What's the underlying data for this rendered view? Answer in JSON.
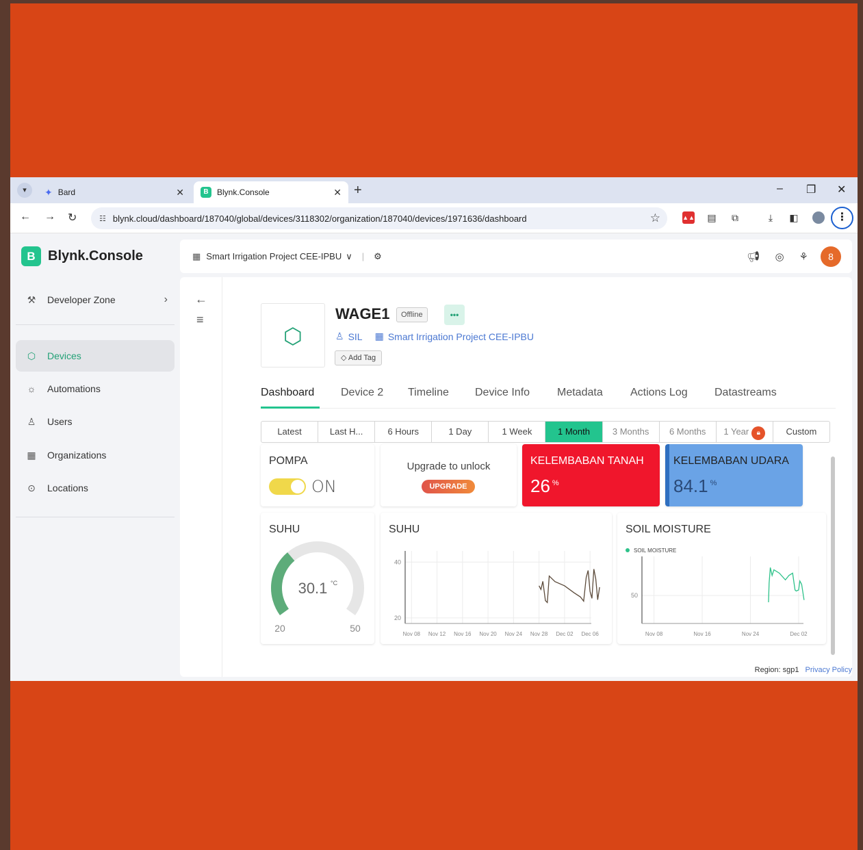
{
  "browser": {
    "tabs": [
      {
        "title": "Bard"
      },
      {
        "title": "Blynk.Console"
      }
    ],
    "url": "blynk.cloud/dashboard/187040/global/devices/3118302/organization/187040/devices/1971636/dashboard",
    "new_tab": "+",
    "win_min": "–",
    "win_max": "❐",
    "win_close": "✕"
  },
  "app": {
    "logo_letter": "B",
    "logo_text": "Blynk.Console",
    "org_name": "Smart Irrigation Project CEE-IPBU",
    "sidebar": [
      {
        "label": "Developer Zone",
        "icon": "tools-icon"
      },
      {
        "label": "Devices",
        "icon": "cube-icon"
      },
      {
        "label": "Automations",
        "icon": "automation-icon"
      },
      {
        "label": "Users",
        "icon": "users-icon"
      },
      {
        "label": "Organizations",
        "icon": "building-icon"
      },
      {
        "label": "Locations",
        "icon": "location-pin-icon"
      }
    ],
    "avatar_letter": "8"
  },
  "device": {
    "name": "WAGE1",
    "status": "Offline",
    "more": "•••",
    "owner": "SIL",
    "organization": "Smart Irrigation Project CEE-IPBU",
    "add_tag": "Add Tag"
  },
  "tabs": [
    "Dashboard",
    "Device 2",
    "Timeline",
    "Device Info",
    "Metadata",
    "Actions Log",
    "Datastreams"
  ],
  "ranges": [
    "Latest",
    "Last H...",
    "6 Hours",
    "1 Day",
    "1 Week",
    "1 Month",
    "3 Months",
    "6 Months",
    "1 Year",
    "Custom"
  ],
  "active_range": "1 Month",
  "widgets": {
    "pompa": {
      "title": "POMPA",
      "state": "ON"
    },
    "upgrade": {
      "text": "Upgrade to unlock",
      "button": "UPGRADE"
    },
    "tanah": {
      "title": "KELEMBABAN TANAH",
      "value": "26",
      "unit": "%",
      "color": "#f0162c"
    },
    "udara": {
      "title": "KELEMBABAN UDARA",
      "value": "84.1",
      "unit": "%",
      "color": "#6aa3e6"
    },
    "gauge": {
      "title": "SUHU",
      "value": "30.1",
      "unit": "°C",
      "min": "20",
      "max": "50",
      "fraction": 0.34,
      "color": "#5dac7a"
    }
  },
  "chart_data": [
    {
      "type": "line",
      "title": "SUHU",
      "ylim": [
        18,
        44
      ],
      "yticks": [
        "40",
        "20"
      ],
      "xticks": [
        "Nov 08",
        "Nov 12",
        "Nov 16",
        "Nov 20",
        "Nov 24",
        "Nov 28",
        "Dec 02",
        "Dec 06"
      ],
      "series": [
        {
          "color": "#5b4a3a",
          "values": [
            [
              21.0,
              31.5
            ],
            [
              21.3,
              30.2
            ],
            [
              21.6,
              33.1
            ],
            [
              22.0,
              26.2
            ],
            [
              22.3,
              25.5
            ],
            [
              22.6,
              35.0
            ],
            [
              23.5,
              33.0
            ],
            [
              25.0,
              31.5
            ],
            [
              26.5,
              29.0
            ],
            [
              27.5,
              27.5
            ],
            [
              28.0,
              26.0
            ],
            [
              28.4,
              34.5
            ],
            [
              28.7,
              37.0
            ],
            [
              29.0,
              29.5
            ],
            [
              29.3,
              27.0
            ],
            [
              29.6,
              37.5
            ],
            [
              29.9,
              34.0
            ],
            [
              30.2,
              26.5
            ],
            [
              30.5,
              31.0
            ]
          ]
        }
      ]
    },
    {
      "type": "line",
      "title": "SOIL MOISTURE",
      "yticks": [
        "50"
      ],
      "ylim": [
        25,
        85
      ],
      "xticks": [
        "Nov 08",
        "Nov 16",
        "Nov 24",
        "Dec 02"
      ],
      "series": [
        {
          "name": "SOIL MOISTURE",
          "color": "#2ec28a",
          "values": [
            [
              21.0,
              44
            ],
            [
              21.1,
              61
            ],
            [
              21.3,
              75
            ],
            [
              21.6,
              68
            ],
            [
              21.9,
              73
            ],
            [
              22.8,
              70
            ],
            [
              23.8,
              64
            ],
            [
              24.4,
              68
            ],
            [
              25.0,
              70
            ],
            [
              25.4,
              55
            ],
            [
              25.6,
              54
            ],
            [
              26.0,
              55
            ],
            [
              26.2,
              63
            ],
            [
              26.5,
              60
            ],
            [
              26.9,
              46
            ]
          ]
        }
      ]
    }
  ],
  "footer": {
    "region": "Region: sgp1",
    "privacy": "Privacy Policy"
  }
}
